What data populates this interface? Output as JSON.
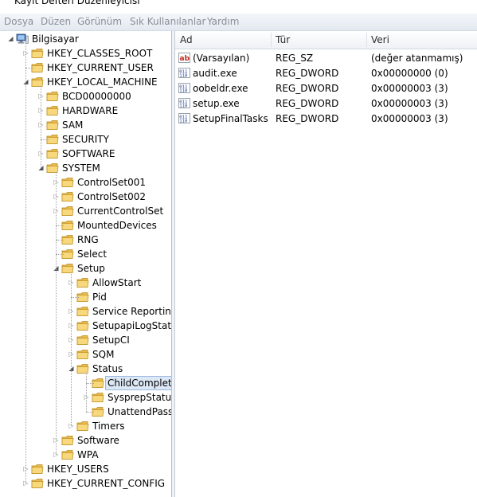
{
  "window": {
    "title": "Kayıt Defteri Düzenleyicisi"
  },
  "menu": [
    "Dosya",
    "Düzen",
    "Görünüm",
    "Sık Kullanılanlar",
    "Yardım"
  ],
  "tree": {
    "root": "Bilgisayar",
    "nodes": [
      "HKEY_CLASSES_ROOT",
      "HKEY_CURRENT_USER",
      "HKEY_LOCAL_MACHINE",
      "BCD00000000",
      "HARDWARE",
      "SAM",
      "SECURITY",
      "SOFTWARE",
      "SYSTEM",
      "ControlSet001",
      "ControlSet002",
      "CurrentControlSet",
      "MountedDevices",
      "RNG",
      "Select",
      "Setup",
      "AllowStart",
      "Pid",
      "Service Reporting",
      "SetupapiLogStatu",
      "SetupCI",
      "SQM",
      "Status",
      "ChildComplet",
      "SysprepStatus",
      "UnattendPass",
      "Timers",
      "Software",
      "WPA",
      "HKEY_USERS",
      "HKEY_CURRENT_CONFIG"
    ]
  },
  "list": {
    "columns": [
      "Ad",
      "Tür",
      "Veri"
    ],
    "rows": [
      {
        "name": "(Varsayılan)",
        "type": "REG_SZ",
        "data": "(değer atanmamış)",
        "icon": "string-value-icon"
      },
      {
        "name": "audit.exe",
        "type": "REG_DWORD",
        "data": "0x00000000 (0)",
        "icon": "binary-value-icon"
      },
      {
        "name": "oobeldr.exe",
        "type": "REG_DWORD",
        "data": "0x00000003 (3)",
        "icon": "binary-value-icon"
      },
      {
        "name": "setup.exe",
        "type": "REG_DWORD",
        "data": "0x00000003 (3)",
        "icon": "binary-value-icon"
      },
      {
        "name": "SetupFinalTasks",
        "type": "REG_DWORD",
        "data": "0x00000003 (3)",
        "icon": "binary-value-icon"
      }
    ]
  }
}
